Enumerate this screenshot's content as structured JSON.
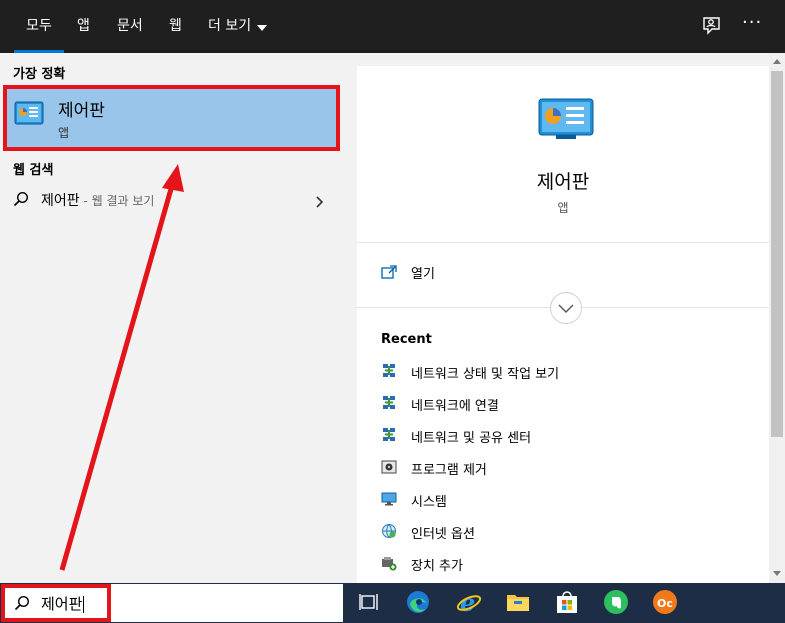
{
  "tabs": {
    "all": "모두",
    "apps": "앱",
    "documents": "문서",
    "web": "웹",
    "more": "더 보기"
  },
  "top_icons": {
    "feedback": "feedback-icon",
    "options": "ellipsis-icon",
    "options_glyph": "···"
  },
  "left": {
    "best_match_label": "가장 정확",
    "best_match": {
      "title": "제어판",
      "subtitle": "앱",
      "icon": "control-panel-icon"
    },
    "web_search_label": "웹 검색",
    "web_query": "제어판",
    "web_hint": " - 웹 결과 보기"
  },
  "right": {
    "app_title": "제어판",
    "app_subtitle": "앱",
    "open_label": "열기",
    "recent_title": "Recent",
    "recent": [
      {
        "label": "네트워크 상태 및 작업 보기",
        "icon": "network-icon"
      },
      {
        "label": "네트워크에 연결",
        "icon": "network-icon"
      },
      {
        "label": "네트워크 및 공유 센터",
        "icon": "network-icon"
      },
      {
        "label": "프로그램 제거",
        "icon": "programs-icon"
      },
      {
        "label": "시스템",
        "icon": "monitor-icon"
      },
      {
        "label": "인터넷 옵션",
        "icon": "internet-options-icon"
      },
      {
        "label": "장치 추가",
        "icon": "add-device-icon"
      }
    ]
  },
  "taskbar": {
    "search_value": "제어판",
    "apps": [
      "task-view-icon",
      "edge-icon",
      "internet-explorer-icon",
      "file-explorer-icon",
      "store-icon",
      "evernote-icon",
      "oc-app-icon"
    ],
    "oc_label": "Oc"
  },
  "colors": {
    "accent": "#0078d4",
    "highlight": "#99c5ea",
    "annotation_red": "#e4141b",
    "taskbar": "#1c2d45"
  }
}
